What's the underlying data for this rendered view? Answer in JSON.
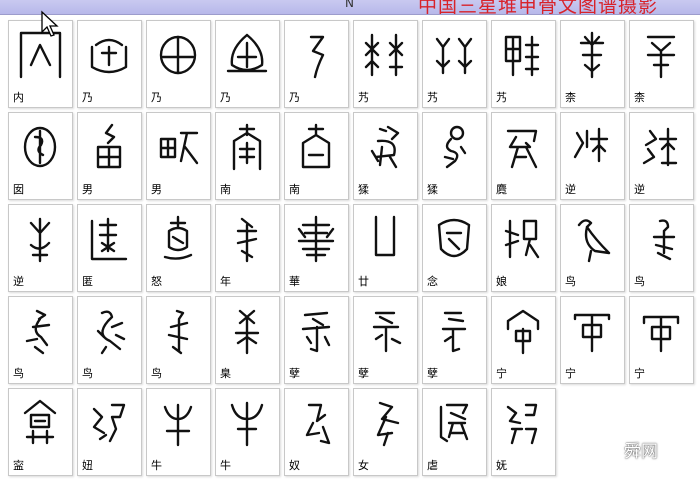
{
  "header": {
    "banner_text": "中国三星堆甲骨文图谱摄影",
    "n_label": "N"
  },
  "watermark": {
    "text": "舜网",
    "icon": "wechat-icon"
  },
  "glyph_cells": [
    {
      "label": "内"
    },
    {
      "label": "乃"
    },
    {
      "label": "乃"
    },
    {
      "label": "乃"
    },
    {
      "label": "乃"
    },
    {
      "label": "艿"
    },
    {
      "label": "艿"
    },
    {
      "label": "艿"
    },
    {
      "label": "柰"
    },
    {
      "label": "柰"
    },
    {
      "label": "囡"
    },
    {
      "label": "男"
    },
    {
      "label": "男"
    },
    {
      "label": "南"
    },
    {
      "label": "南"
    },
    {
      "label": "猱"
    },
    {
      "label": "猱"
    },
    {
      "label": "麑"
    },
    {
      "label": "逆"
    },
    {
      "label": "逆"
    },
    {
      "label": "逆"
    },
    {
      "label": "匿"
    },
    {
      "label": "怒"
    },
    {
      "label": "年"
    },
    {
      "label": "華"
    },
    {
      "label": "廿"
    },
    {
      "label": "念"
    },
    {
      "label": "娘"
    },
    {
      "label": "鸟"
    },
    {
      "label": "鸟"
    },
    {
      "label": "鸟"
    },
    {
      "label": "鸟"
    },
    {
      "label": "鸟"
    },
    {
      "label": "臬"
    },
    {
      "label": "孽"
    },
    {
      "label": "孽"
    },
    {
      "label": "孽"
    },
    {
      "label": "宁"
    },
    {
      "label": "宁"
    },
    {
      "label": "宁"
    },
    {
      "label": "寍"
    },
    {
      "label": "妞"
    },
    {
      "label": "牛"
    },
    {
      "label": "牛"
    },
    {
      "label": "奴"
    },
    {
      "label": "女"
    },
    {
      "label": "虐"
    },
    {
      "label": "妩"
    }
  ]
}
